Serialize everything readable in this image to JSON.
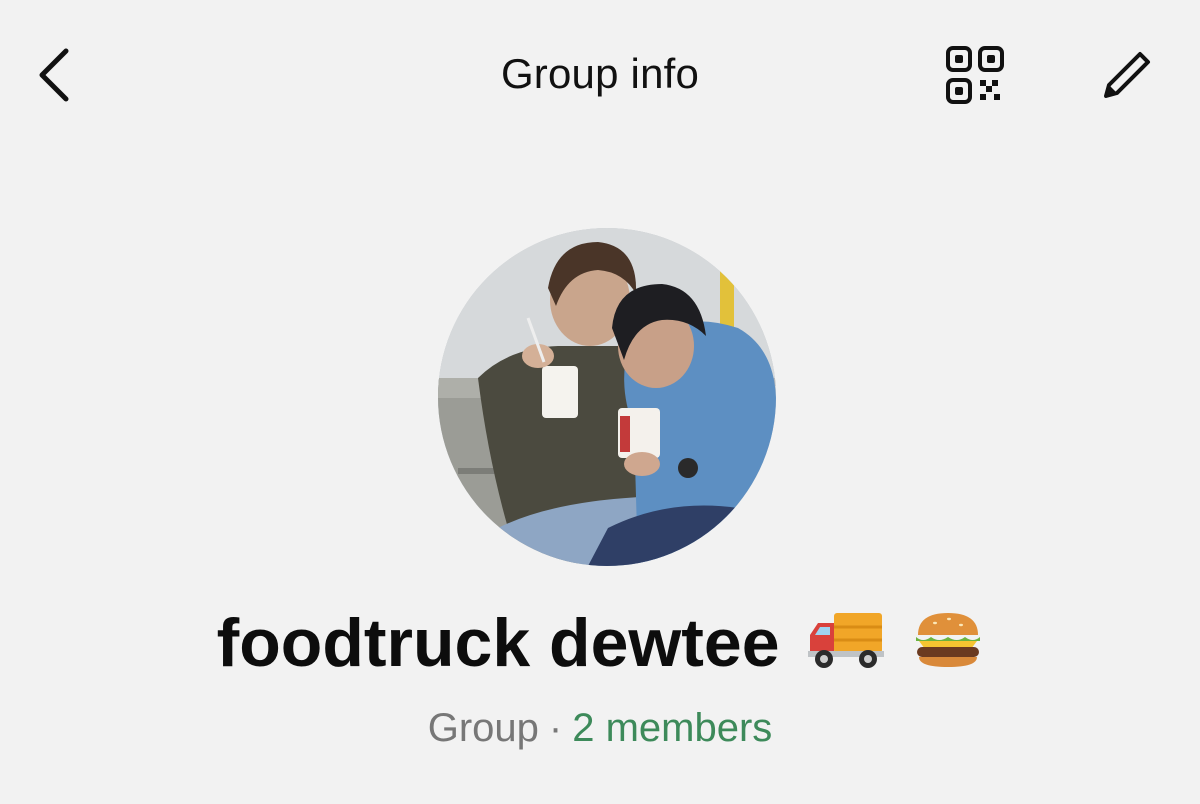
{
  "header": {
    "title": "Group info",
    "back_icon": "chevron-left-icon",
    "qr_icon": "qr-code-icon",
    "edit_icon": "pencil-icon"
  },
  "group": {
    "name": "foodtruck dewtee",
    "emojis": [
      "delivery-truck-emoji",
      "hamburger-emoji"
    ],
    "type": "Group",
    "separator": "·",
    "members": "2 members"
  },
  "colors": {
    "background": "#f2f2f2",
    "members_link": "#3d8a5a",
    "muted": "#777777"
  }
}
